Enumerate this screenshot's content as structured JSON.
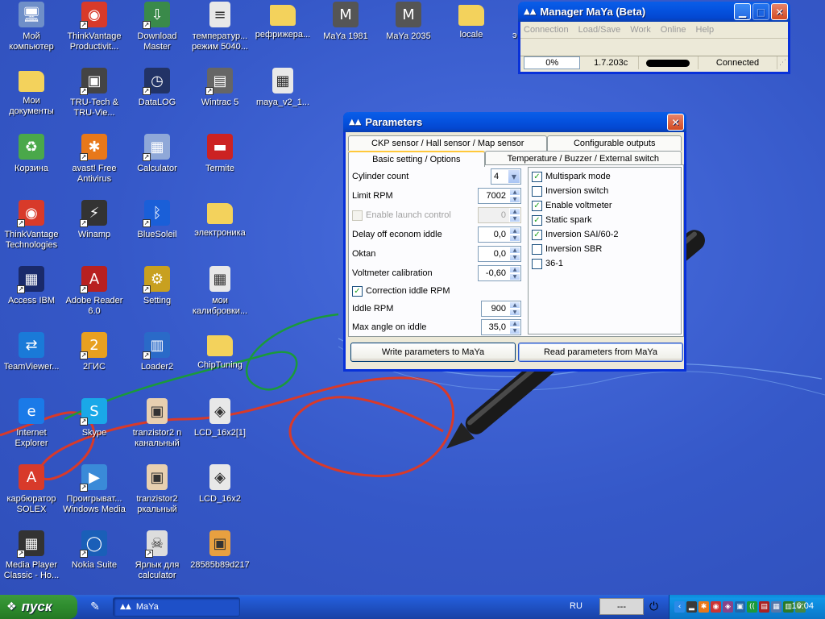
{
  "desktop": {
    "icons": [
      {
        "label": "Мой компьютер",
        "icon": "my-computer-icon",
        "glyph": "🖥",
        "color": "#6f8fc8",
        "shortcut": false
      },
      {
        "label": "ThinkVantage Productivit...",
        "icon": "thinkvantage-icon",
        "glyph": "◉",
        "color": "#d83a2a",
        "shortcut": true
      },
      {
        "label": "Download Master",
        "icon": "download-master-icon",
        "glyph": "⇩",
        "color": "#3a8a4a",
        "shortcut": true
      },
      {
        "label": "температур... режим 5040...",
        "icon": "text-document-icon",
        "glyph": "≡",
        "color": "#e8e8e8",
        "shortcut": false
      },
      {
        "label": "рефрижера...",
        "icon": "folder-icon",
        "glyph": "",
        "color": "#f3d25c",
        "shortcut": false
      },
      {
        "label": "MaYa 1981",
        "icon": "maya-app-icon",
        "glyph": "M",
        "color": "#555555",
        "shortcut": false
      },
      {
        "label": "MaYa 2035",
        "icon": "maya-app-icon",
        "glyph": "M",
        "color": "#555555",
        "shortcut": false
      },
      {
        "label": "locale",
        "icon": "folder-icon",
        "glyph": "",
        "color": "#f3d25c",
        "shortcut": false
      },
      {
        "label": "Мои документы",
        "icon": "my-documents-icon",
        "glyph": "",
        "color": "#f3d25c",
        "shortcut": false
      },
      {
        "label": "TRU-Tech & TRU-Vie...",
        "icon": "tru-tech-icon",
        "glyph": "▣",
        "color": "#444444",
        "shortcut": true
      },
      {
        "label": "DataLOG",
        "icon": "datalog-icon",
        "glyph": "◷",
        "color": "#223366",
        "shortcut": true
      },
      {
        "label": "Wintrac 5",
        "icon": "wintrac-icon",
        "glyph": "▤",
        "color": "#666666",
        "shortcut": true
      },
      {
        "label": "maya_v2_1...",
        "icon": "document-icon",
        "glyph": "▦",
        "color": "#e8e8e8",
        "shortcut": false
      },
      {
        "label": "Корзина",
        "icon": "recycle-bin-icon",
        "glyph": "♻",
        "color": "#4aa84a",
        "shortcut": false
      },
      {
        "label": "avast! Free Antivirus",
        "icon": "avast-icon",
        "glyph": "✱",
        "color": "#e8781a",
        "shortcut": true
      },
      {
        "label": "Calculator",
        "icon": "calculator-icon",
        "glyph": "▦",
        "color": "#8fa8d8",
        "shortcut": true
      },
      {
        "label": "Termite",
        "icon": "termite-icon",
        "glyph": "▬",
        "color": "#cc2222",
        "shortcut": false
      },
      {
        "label": "ThinkVantage Technologies",
        "icon": "thinkvantage-tech-icon",
        "glyph": "◉",
        "color": "#d83a2a",
        "shortcut": true
      },
      {
        "label": "Winamp",
        "icon": "winamp-icon",
        "glyph": "⚡",
        "color": "#333333",
        "shortcut": true
      },
      {
        "label": "BlueSoleil",
        "icon": "bluetooth-icon",
        "glyph": "ᛒ",
        "color": "#1a5fd8",
        "shortcut": true
      },
      {
        "label": "электроника",
        "icon": "folder-icon",
        "glyph": "",
        "color": "#f3d25c",
        "shortcut": false
      },
      {
        "label": "Access IBM",
        "icon": "access-ibm-icon",
        "glyph": "▦",
        "color": "#1a2a6a",
        "shortcut": true
      },
      {
        "label": "Adobe Reader 6.0",
        "icon": "adobe-reader-icon",
        "glyph": "A",
        "color": "#b82020",
        "shortcut": true
      },
      {
        "label": "Setting",
        "icon": "setting-icon",
        "glyph": "⚙",
        "color": "#c8a020",
        "shortcut": true
      },
      {
        "label": "мои калибровки...",
        "icon": "document-icon",
        "glyph": "▦",
        "color": "#e8e8e8",
        "shortcut": false
      },
      {
        "label": "TeamViewer...",
        "icon": "teamviewer-icon",
        "glyph": "⇄",
        "color": "#1a7ad8",
        "shortcut": false
      },
      {
        "label": "2ГИС",
        "icon": "2gis-icon",
        "glyph": "2",
        "color": "#e8a020",
        "shortcut": true
      },
      {
        "label": "Loader2",
        "icon": "loader-icon",
        "glyph": "▥",
        "color": "#2a6ac8",
        "shortcut": true
      },
      {
        "label": "ChipTuning",
        "icon": "folder-icon",
        "glyph": "",
        "color": "#f3d25c",
        "shortcut": false
      },
      {
        "label": "Internet Explorer",
        "icon": "internet-explorer-icon",
        "glyph": "e",
        "color": "#1a7ae8",
        "shortcut": false
      },
      {
        "label": "Skype",
        "icon": "skype-icon",
        "glyph": "S",
        "color": "#1aa8e8",
        "shortcut": true
      },
      {
        "label": "tranzistor2 n канальный",
        "icon": "image-file-icon",
        "glyph": "▣",
        "color": "#e8d0b0",
        "shortcut": false
      },
      {
        "label": "LCD_16x2[1]",
        "icon": "image-file-icon",
        "glyph": "◈",
        "color": "#e8e8e8",
        "shortcut": false
      },
      {
        "label": "карбюратор SOLEX",
        "icon": "pdf-icon",
        "glyph": "A",
        "color": "#d83a2a",
        "shortcut": false
      },
      {
        "label": "Проигрыват... Windows Media",
        "icon": "windows-media-player-icon",
        "glyph": "▶",
        "color": "#3a8ad8",
        "shortcut": true
      },
      {
        "label": "tranzistor2 ркальный",
        "icon": "image-file-icon",
        "glyph": "▣",
        "color": "#e8d0b0",
        "shortcut": false
      },
      {
        "label": "LCD_16x2",
        "icon": "image-file-icon",
        "glyph": "◈",
        "color": "#e8e8e8",
        "shortcut": false
      },
      {
        "label": "Media Player Classic - Ho...",
        "icon": "media-player-classic-icon",
        "glyph": "▦",
        "color": "#333333",
        "shortcut": true
      },
      {
        "label": "Nokia Suite",
        "icon": "nokia-suite-icon",
        "glyph": "◯",
        "color": "#1a5fb8",
        "shortcut": true
      },
      {
        "label": "Ярлык для calculator",
        "icon": "skull-icon",
        "glyph": "☠",
        "color": "#dddddd",
        "shortcut": true
      },
      {
        "label": "28585b89d217",
        "icon": "image-file-icon",
        "glyph": "▣",
        "color": "#e8a040",
        "shortcut": false
      }
    ],
    "partial_label": "э"
  },
  "manager": {
    "title": "Manager MaYa (Beta)",
    "menu": [
      "Connection",
      "Load/Save",
      "Work",
      "Online",
      "Help"
    ],
    "status": {
      "progress": "0%",
      "version": "1.7.203c",
      "connection": "Connected"
    }
  },
  "params": {
    "title": "Parameters",
    "tabs_row1": [
      "CKP sensor / Hall sensor / Map sensor",
      "Configurable outputs"
    ],
    "tabs_row2": [
      "Basic setting / Options",
      "Temperature / Buzzer / External switch"
    ],
    "fields": {
      "cylinder_count": {
        "label": "Cylinder count",
        "value": "4"
      },
      "limit_rpm": {
        "label": "Limit RPM",
        "value": "7002"
      },
      "launch_control": {
        "label": "Enable launch control",
        "value": "0"
      },
      "delay_econom": {
        "label": "Delay off econom iddle",
        "value": "0,0"
      },
      "oktan": {
        "label": "Oktan",
        "value": "0,0"
      },
      "voltmeter_cal": {
        "label": "Voltmeter calibration",
        "value": "-0,60"
      },
      "correction_idle": {
        "label": "Correction iddle RPM"
      },
      "idle_rpm": {
        "label": "Iddle RPM",
        "value": "900"
      },
      "max_angle": {
        "label": "Max angle on iddle",
        "value": "35,0"
      }
    },
    "options": [
      {
        "label": "Multispark mode",
        "checked": true
      },
      {
        "label": "Inversion switch",
        "checked": false
      },
      {
        "label": "Enable voltmeter",
        "checked": true
      },
      {
        "label": "Static spark",
        "checked": true
      },
      {
        "label": "Inversion SAI/60-2",
        "checked": true
      },
      {
        "label": "Inversion SBR",
        "checked": false
      },
      {
        "label": "36-1",
        "checked": false
      }
    ],
    "buttons": {
      "write": "Write parameters to MaYa",
      "read": "Read parameters from MaYa"
    }
  },
  "taskbar": {
    "start_label": "пуск",
    "task": "MaYa",
    "lang": "RU",
    "tray_field": "---",
    "clock": "16:04"
  }
}
